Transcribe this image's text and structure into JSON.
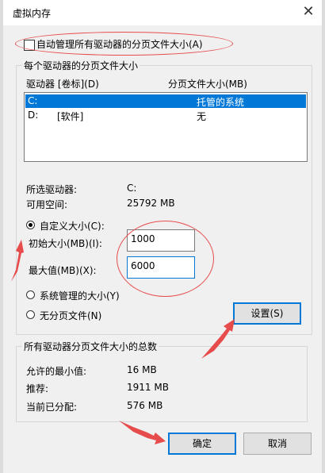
{
  "window": {
    "title": "虚拟内存",
    "close_glyph": "✕"
  },
  "auto_manage": {
    "label": "自动管理所有驱动器的分页文件大小(A)",
    "checked": false
  },
  "per_drive": {
    "group_title": "每个驱动器的分页文件大小",
    "col_drive": "驱动器 [卷标](D)",
    "col_size": "分页文件大小(MB)",
    "rows": [
      {
        "drive": "C:",
        "label": "",
        "size": "托管的系统",
        "selected": true
      },
      {
        "drive": "D:",
        "label": "[软件]",
        "size": "无",
        "selected": false
      }
    ],
    "selected_drive_label": "所选驱动器:",
    "selected_drive_value": "C:",
    "space_label": "可用空间:",
    "space_value": "25792 MB",
    "custom_label": "自定义大小(C):",
    "initial_label": "初始大小(MB)(I):",
    "initial_value": "1000",
    "max_label": "最大值(MB)(X):",
    "max_value": "6000",
    "system_label": "系统管理的大小(Y)",
    "none_label": "无分页文件(N)",
    "set_button": "设置(S)",
    "selected_option": "custom"
  },
  "totals": {
    "group_title": "所有驱动器分页文件大小的总数",
    "min_label": "允许的最小值:",
    "min_value": "16 MB",
    "rec_label": "推荐:",
    "rec_value": "1911 MB",
    "cur_label": "当前已分配:",
    "cur_value": "576 MB"
  },
  "buttons": {
    "ok": "确定",
    "cancel": "取消"
  },
  "colors": {
    "annotation_red": "#e74c4c",
    "selection_blue": "#0078d7"
  }
}
